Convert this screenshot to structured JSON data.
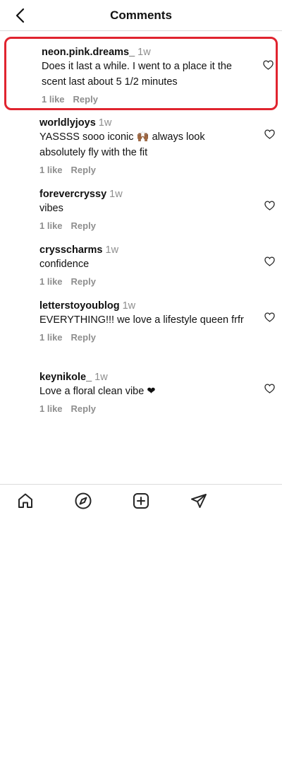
{
  "header": {
    "title": "Comments",
    "back_icon": "chevron-left-icon"
  },
  "comments": [
    {
      "user": "neon.pink.dreams_",
      "time": "1w",
      "text": "Does it last a while. I went to a place it the scent last about 5 1/2 minutes",
      "likes": "1 like",
      "reply": "Reply",
      "highlighted": true
    },
    {
      "user": "worldlyjoys",
      "time": "1w",
      "text": "YASSSS sooo iconic 🙌🏾 always look absolutely fly with the fit",
      "likes": "1 like",
      "reply": "Reply"
    },
    {
      "user": "forevercryssy",
      "time": "1w",
      "text": "vibes",
      "likes": "1 like",
      "reply": "Reply"
    },
    {
      "user": "crysscharms",
      "time": "1w",
      "text": "confidence",
      "likes": "1 like",
      "reply": "Reply"
    },
    {
      "user": "letterstoyoublog",
      "time": "1w",
      "text": "EVERYTHING!!! we love a lifestyle queen frfr",
      "likes": "1 like",
      "reply": "Reply"
    },
    {
      "user": "keynikole_",
      "time": "1w",
      "text": "Love a floral clean vibe ❤",
      "likes": "1 like",
      "reply": "Reply"
    }
  ],
  "bottom_nav": {
    "items": [
      {
        "icon": "home-icon"
      },
      {
        "icon": "compass-icon"
      },
      {
        "icon": "add-post-icon"
      },
      {
        "icon": "send-icon"
      }
    ]
  },
  "colors": {
    "highlight": "#e0242f",
    "muted": "#8e8e8e",
    "divider": "#dbdbdb"
  }
}
